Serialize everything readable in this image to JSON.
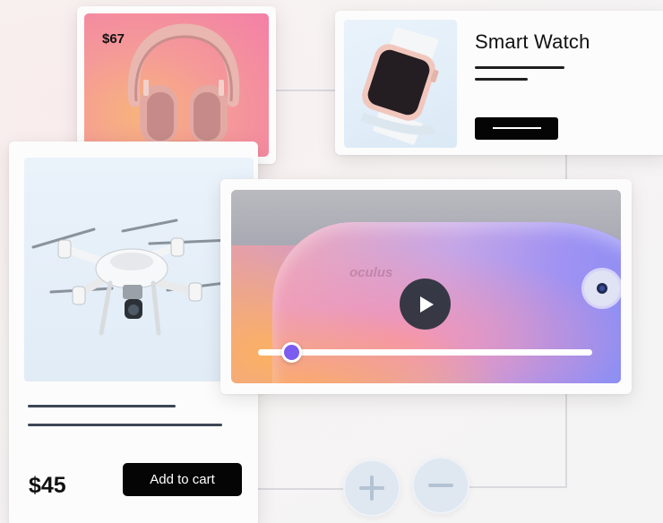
{
  "headphones": {
    "price": "$67",
    "icon": "headphones-image"
  },
  "smart_watch": {
    "title": "Smart Watch",
    "icon": "smartwatch-image"
  },
  "drone": {
    "price": "$45",
    "add_to_cart_label": "Add to cart",
    "icon": "drone-image"
  },
  "video": {
    "brand": "oculus",
    "progress": 0.1,
    "icon": "play-icon"
  },
  "zoom": {
    "zoom_in_icon": "plus-icon",
    "zoom_out_icon": "minus-icon"
  },
  "colors": {
    "accent": "#7c5cf0",
    "button": "#050505",
    "headphones_bg": "#f59a98",
    "watch_bg": "#e3eef8",
    "drone_bg": "#e6eff8"
  }
}
